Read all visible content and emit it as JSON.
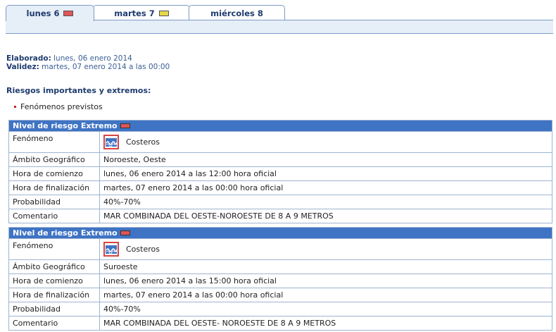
{
  "tabs": [
    {
      "label": "lunes 6",
      "swatch": "#e05555",
      "active": true
    },
    {
      "label": "martes 7",
      "swatch": "#e6d84a",
      "active": false
    },
    {
      "label": "miércoles 8",
      "swatch": null,
      "active": false
    }
  ],
  "meta": {
    "elaborado_label": "Elaborado:",
    "elaborado_value": "lunes, 06 enero 2014",
    "validez_label": "Validez:",
    "validez_value": "martes, 07 enero 2014 a las 00:00"
  },
  "section_title": "Riesgos importantes y extremos:",
  "bullet_text": "Fenómenos previstos",
  "risks": [
    {
      "header": "Nivel de riesgo Extremo",
      "header_swatch": "#e05555",
      "icon": "coastal-waves-icon",
      "rows": [
        {
          "label": "Fenómeno",
          "value": "Costeros"
        },
        {
          "label": "Ámbito Geográfico",
          "value": "Noroeste, Oeste"
        },
        {
          "label": "Hora de comienzo",
          "value": "lunes, 06 enero 2014 a las 12:00 hora oficial"
        },
        {
          "label": "Hora de finalización",
          "value": "martes, 07 enero 2014 a las 00:00 hora oficial"
        },
        {
          "label": "Probabilidad",
          "value": "40%-70%"
        },
        {
          "label": "Comentario",
          "value": "MAR COMBINADA DEL OESTE-NOROESTE DE 8 A 9 METROS"
        }
      ]
    },
    {
      "header": "Nivel de riesgo Extremo",
      "header_swatch": "#e05555",
      "icon": "coastal-waves-icon",
      "rows": [
        {
          "label": "Fenómeno",
          "value": "Costeros"
        },
        {
          "label": "Ámbito Geográfico",
          "value": "Suroeste"
        },
        {
          "label": "Hora de comienzo",
          "value": "lunes, 06 enero 2014 a las 15:00 hora oficial"
        },
        {
          "label": "Hora de finalización",
          "value": "martes, 07 enero 2014 a las 00:00 hora oficial"
        },
        {
          "label": "Probabilidad",
          "value": "40%-70%"
        },
        {
          "label": "Comentario",
          "value": "MAR COMBINADA DEL OESTE- NOROESTE DE 8 A 9 METROS"
        }
      ]
    }
  ]
}
